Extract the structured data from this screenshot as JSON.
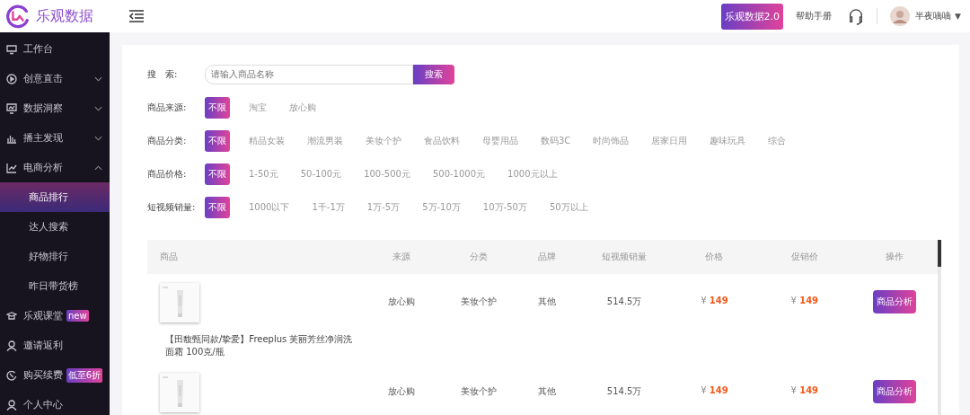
{
  "header": {
    "logo_text": "乐观数据",
    "version_button": "乐观数据2.0",
    "help_link": "帮助手册",
    "user": {
      "name": "半夜嘀嘀",
      "caret": "▼"
    }
  },
  "sidebar": {
    "items": [
      {
        "label": "工作台"
      },
      {
        "label": "创意直击",
        "expanded": false
      },
      {
        "label": "数据洞察",
        "expanded": false
      },
      {
        "label": "播主发现",
        "expanded": false
      },
      {
        "label": "电商分析",
        "expanded": true,
        "children": [
          {
            "label": "商品排行",
            "selected": true
          },
          {
            "label": "达人搜索",
            "selected": false
          },
          {
            "label": "好物排行",
            "selected": false
          },
          {
            "label": "昨日带货榜",
            "selected": false
          }
        ]
      },
      {
        "label": "乐观课堂",
        "badge": "new"
      },
      {
        "label": "邀请返利"
      },
      {
        "label": "购买续费",
        "badge": "低至6折"
      },
      {
        "label": "个人中心"
      }
    ]
  },
  "search": {
    "label": "搜　索:",
    "placeholder": "请输入商品名称",
    "button": "搜索"
  },
  "filters": [
    {
      "label": "商品来源:",
      "options": [
        {
          "label": "不限",
          "selected": true
        },
        {
          "label": "淘宝",
          "selected": false
        },
        {
          "label": "放心购",
          "selected": false
        }
      ]
    },
    {
      "label": "商品分类:",
      "options": [
        {
          "label": "不限",
          "selected": true
        },
        {
          "label": "精品女装",
          "selected": false
        },
        {
          "label": "潮流男装",
          "selected": false
        },
        {
          "label": "美妆个护",
          "selected": false
        },
        {
          "label": "食品饮料",
          "selected": false
        },
        {
          "label": "母婴用品",
          "selected": false
        },
        {
          "label": "数码3C",
          "selected": false
        },
        {
          "label": "时尚饰品",
          "selected": false
        },
        {
          "label": "居家日用",
          "selected": false
        },
        {
          "label": "趣味玩具",
          "selected": false
        },
        {
          "label": "综合",
          "selected": false
        }
      ]
    },
    {
      "label": "商品价格:",
      "options": [
        {
          "label": "不限",
          "selected": true
        },
        {
          "label": "1-50元",
          "selected": false
        },
        {
          "label": "50-100元",
          "selected": false
        },
        {
          "label": "100-500元",
          "selected": false
        },
        {
          "label": "500-1000元",
          "selected": false
        },
        {
          "label": "1000元以上",
          "selected": false
        }
      ]
    },
    {
      "label": "短视频销量:",
      "options": [
        {
          "label": "不限",
          "selected": true
        },
        {
          "label": "1000以下",
          "selected": false
        },
        {
          "label": "1千-1万",
          "selected": false
        },
        {
          "label": "1万-5万",
          "selected": false
        },
        {
          "label": "5万-10万",
          "selected": false
        },
        {
          "label": "10万-50万",
          "selected": false
        },
        {
          "label": "50万以上",
          "selected": false
        }
      ]
    }
  ],
  "table": {
    "columns": [
      "商品",
      "来源",
      "分类",
      "品牌",
      "短视频销量",
      "价格",
      "促销价",
      "操作"
    ],
    "rows": [
      {
        "name": "【田馥甄同款/挚爱】Freeplus 芙丽芳丝净润洗面霜 100克/瓶",
        "source": "放心购",
        "category": "美妆个护",
        "brand": "其他",
        "sales": "514.5万",
        "price": {
          "symbol": "¥",
          "amount": "149"
        },
        "promo_price": {
          "symbol": "¥",
          "amount": "149"
        },
        "action": "商品分析"
      },
      {
        "source": "放心购",
        "category": "美妆个护",
        "brand": "其他",
        "sales": "514.5万",
        "price": {
          "symbol": "¥",
          "amount": "149"
        },
        "promo_price": {
          "symbol": "¥",
          "amount": "149"
        },
        "action": "商品分析"
      }
    ]
  }
}
